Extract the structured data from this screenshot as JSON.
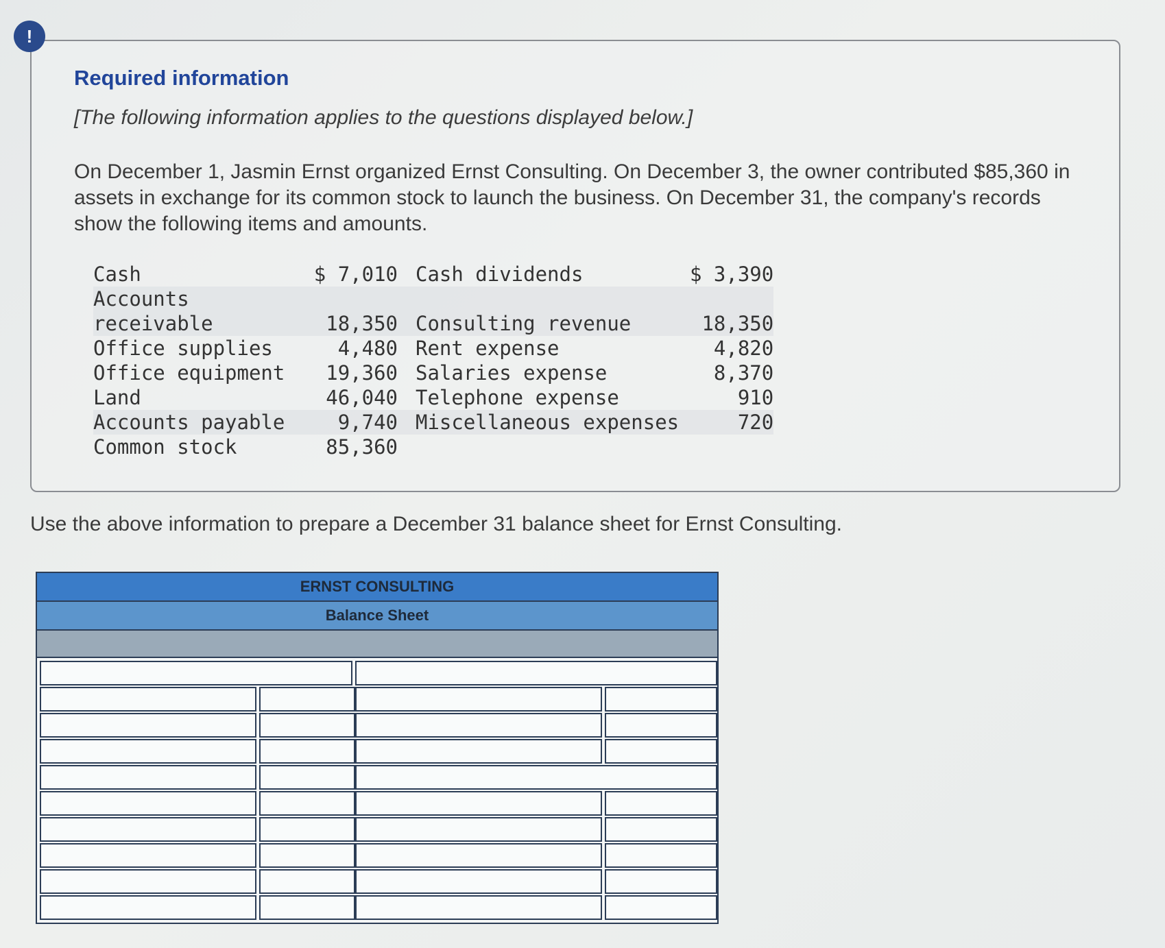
{
  "alert_icon": "!",
  "info": {
    "title": "Required information",
    "subtitle": "[The following information applies to the questions displayed below.]",
    "paragraph": "On December 1, Jasmin Ernst organized Ernst Consulting. On December 3, the owner contributed $85,360 in assets in exchange for its common stock to launch the business. On December 31, the company's records show the following items and amounts."
  },
  "items_left": [
    {
      "label": "Cash",
      "amount": "$ 7,010"
    },
    {
      "label": "Accounts\nreceivable",
      "amount": "18,350"
    },
    {
      "label": "Office supplies",
      "amount": "4,480"
    },
    {
      "label": "Office equipment",
      "amount": "19,360"
    },
    {
      "label": "Land",
      "amount": "46,040"
    },
    {
      "label": "Accounts payable",
      "amount": "9,740"
    },
    {
      "label": "Common stock",
      "amount": "85,360"
    }
  ],
  "items_right": [
    {
      "label": "Cash dividends",
      "amount": "$ 3,390"
    },
    {
      "label": "Consulting revenue",
      "amount": "18,350"
    },
    {
      "label": "Rent expense",
      "amount": "4,820"
    },
    {
      "label": "Salaries expense",
      "amount": "8,370"
    },
    {
      "label": "Telephone expense",
      "amount": "910"
    },
    {
      "label": "Miscellaneous expenses",
      "amount": "720"
    },
    {
      "label": "",
      "amount": ""
    }
  ],
  "instruction": "Use the above information to prepare a December 31 balance sheet for Ernst Consulting.",
  "balance_sheet": {
    "company": "ERNST CONSULTING",
    "title": "Balance Sheet",
    "date_value": ""
  }
}
